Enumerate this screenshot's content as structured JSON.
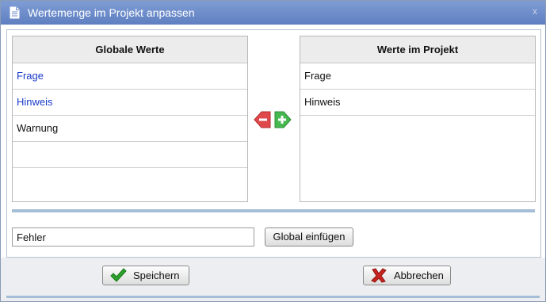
{
  "window": {
    "title": "Wertemenge im Projekt anpassen",
    "close_label": "x"
  },
  "global_list": {
    "header": "Globale Werte",
    "items": [
      "Frage",
      "Hinweis",
      "Warnung"
    ]
  },
  "project_list": {
    "header": "Werte im Projekt",
    "items": [
      "Frage",
      "Hinweis"
    ]
  },
  "input": {
    "value": "Fehler"
  },
  "buttons": {
    "global_insert": "Global einfügen",
    "save": "Speichern",
    "cancel": "Abbrechen"
  },
  "colors": {
    "titlebar": "#6f8ecb",
    "global_item_text": "#1a3bc9",
    "remove_arrow": "#e0494b",
    "add_arrow": "#45b850",
    "save_check": "#2aa12a",
    "cancel_x": "#c8231f"
  },
  "icons": {
    "title": "document-icon",
    "remove": "arrow-left-minus-icon",
    "add": "arrow-right-plus-icon",
    "save": "checkmark-icon",
    "cancel": "x-icon"
  }
}
